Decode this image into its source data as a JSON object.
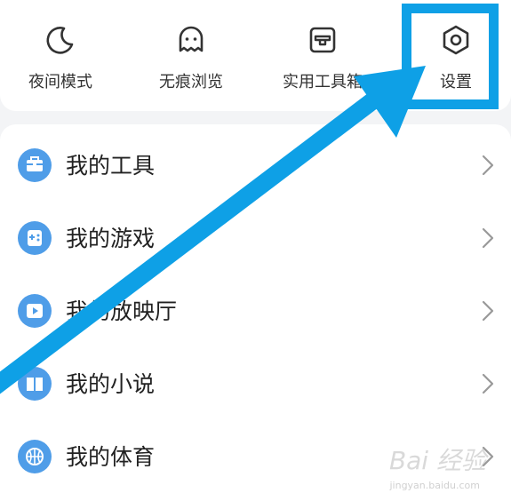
{
  "quick_actions": [
    {
      "label": "夜间模式",
      "icon": "moon-icon"
    },
    {
      "label": "无痕浏览",
      "icon": "ghost-icon"
    },
    {
      "label": "实用工具箱",
      "icon": "toolbox-icon"
    },
    {
      "label": "设置",
      "icon": "hexagon-settings-icon"
    }
  ],
  "menu_items": [
    {
      "label": "我的工具",
      "icon": "briefcase-icon"
    },
    {
      "label": "我的游戏",
      "icon": "game-controller-icon"
    },
    {
      "label": "我的放映厅",
      "icon": "video-play-icon"
    },
    {
      "label": "我的小说",
      "icon": "book-icon"
    },
    {
      "label": "我的体育",
      "icon": "basketball-icon"
    }
  ],
  "watermark": {
    "text": "Bai 经验",
    "subtext": "jingyan.baidu.com"
  },
  "colors": {
    "accent_blue": "#4f9de8",
    "annotation_blue": "#0ea0e6",
    "background": "#f3f4f6"
  }
}
